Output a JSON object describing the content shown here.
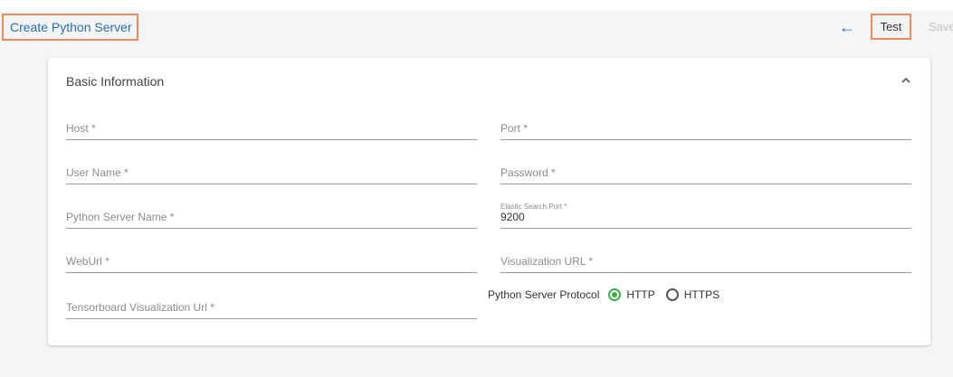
{
  "header": {
    "title": "Create Python Server",
    "back_icon": "arrow-left-icon",
    "test_label": "Test",
    "save_label": "Save"
  },
  "card": {
    "section_title": "Basic Information",
    "collapse_icon": "chevron-up-icon"
  },
  "fields": {
    "host": {
      "placeholder": "Host *",
      "value": ""
    },
    "port": {
      "placeholder": "Port *",
      "value": ""
    },
    "user_name": {
      "placeholder": "User Name *",
      "value": ""
    },
    "password": {
      "placeholder": "Password *",
      "value": ""
    },
    "python_server_name": {
      "placeholder": "Python Server Name *",
      "value": ""
    },
    "elastic_search_port": {
      "label": "Elastic Search Port *",
      "value": "9200"
    },
    "weburl": {
      "placeholder": "WebUrl *",
      "value": ""
    },
    "visualization_url": {
      "placeholder": "Visualization URL *",
      "value": ""
    },
    "tensorboard_visualization_url": {
      "placeholder": "Tensorboard Visualization Url *",
      "value": ""
    }
  },
  "protocol": {
    "label": "Python Server Protocol",
    "options": [
      "HTTP",
      "HTTPS"
    ],
    "selected": "HTTP"
  },
  "colors": {
    "accent_orange": "#f08a5d",
    "link_blue": "#2b6bb3",
    "radio_green": "#3fae49"
  }
}
